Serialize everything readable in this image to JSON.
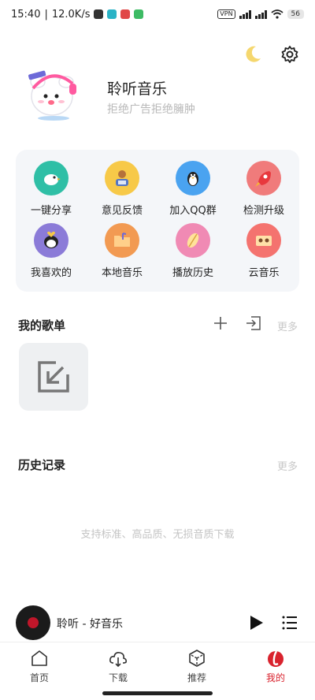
{
  "status_bar": {
    "time": "15:40",
    "net_speed": "12.0K/s",
    "vpn": "VPN",
    "battery": "56"
  },
  "profile": {
    "app_name": "聆听音乐",
    "slogan": "拒绝广告拒绝臃肿"
  },
  "quick_grid": [
    {
      "label": "一键分享",
      "icon": "share-bird-icon",
      "color": "#2fbfa6"
    },
    {
      "label": "意见反馈",
      "icon": "feedback-person-icon",
      "color": "#f7c948"
    },
    {
      "label": "加入QQ群",
      "icon": "qq-penguin-icon",
      "color": "#4aa3f0"
    },
    {
      "label": "检测升级",
      "icon": "rocket-icon",
      "color": "#f07b7b"
    },
    {
      "label": "我喜欢的",
      "icon": "heart-penguin-icon",
      "color": "#8b7bd8"
    },
    {
      "label": "本地音乐",
      "icon": "folder-icon",
      "color": "#f29a52"
    },
    {
      "label": "播放历史",
      "icon": "history-feather-icon",
      "color": "#f08ab4"
    },
    {
      "label": "云音乐",
      "icon": "cassette-icon",
      "color": "#f4736f"
    }
  ],
  "playlists": {
    "title": "我的歌单",
    "more": "更多"
  },
  "history": {
    "title": "历史记录",
    "more": "更多",
    "empty_hint": "支持标准、高品质、无损音质下载"
  },
  "mini_player": {
    "track": "聆听 - 好音乐"
  },
  "bottom_nav": [
    {
      "label": "首页",
      "icon": "home-icon",
      "active": false
    },
    {
      "label": "下载",
      "icon": "download-cloud-icon",
      "active": false
    },
    {
      "label": "推荐",
      "icon": "recommend-cube-icon",
      "active": false
    },
    {
      "label": "我的",
      "icon": "profile-logo-icon",
      "active": true
    }
  ],
  "colors": {
    "accent": "#d9232e",
    "muted": "#c4c4c4",
    "card_bg": "#f4f6f9"
  }
}
